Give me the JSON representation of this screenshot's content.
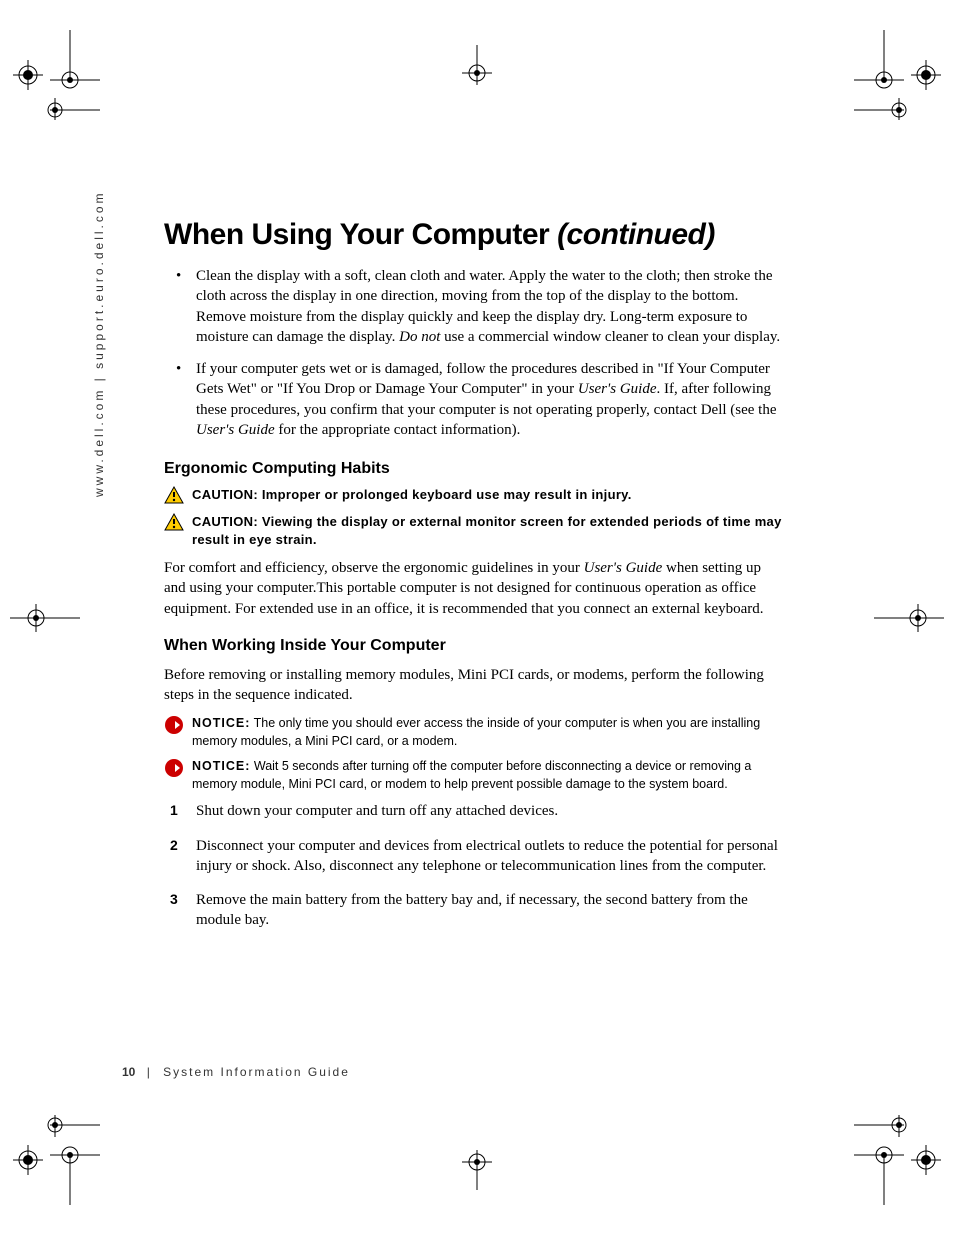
{
  "sidebar": "www.dell.com | support.euro.dell.com",
  "title_main": "When Using Your Computer ",
  "title_ital": "(continued)",
  "bullets": [
    {
      "pre": "Clean the display with a soft, clean cloth and water. Apply the water to the cloth; then stroke the cloth across the display in one direction, moving from the top of the display to the bottom. Remove moisture from the display quickly and keep the display dry. Long-term exposure to moisture can damage the display. ",
      "ital": "Do not",
      "post": " use a commercial window cleaner to clean your display."
    },
    {
      "pre": "If your computer gets wet or is damaged, follow the procedures described in \"If Your Computer Gets Wet\" or \"If You Drop or Damage Your Computer\" in your ",
      "ital": "User's Guide",
      "post": ". If, after following these procedures, you confirm that your computer is not operating properly, contact Dell (see the ",
      "ital2": "User's Guide",
      "post2": " for the appropriate contact information)."
    }
  ],
  "sub1": "Ergonomic Computing Habits",
  "cautions": [
    "CAUTION: Improper or prolonged keyboard use may result in injury.",
    "CAUTION: Viewing the display or external monitor screen for extended periods of time may result in eye strain."
  ],
  "para1_pre": "For comfort and efficiency, observe the ergonomic guidelines in your ",
  "para1_ital": "User's Guide",
  "para1_post": " when setting up and using your computer.This portable computer is not designed for continuous operation as office equipment. For extended use in an office, it is recommended that you connect an external keyboard.",
  "sub2": "When Working Inside Your Computer",
  "para2": "Before removing or installing memory modules, Mini PCI cards, or modems, perform the following steps in the sequence indicated.",
  "notices": [
    {
      "lead": "NOTICE:",
      "body": " The only time you should ever access the inside of your computer is when you are installing memory modules, a Mini PCI card, or a modem."
    },
    {
      "lead": "NOTICE:",
      "body": " Wait 5 seconds after turning off the computer before disconnecting a device or removing a memory module, Mini PCI card, or modem to help prevent possible damage to the system board."
    }
  ],
  "steps": [
    "Shut down your computer and turn off any attached devices.",
    "Disconnect your computer and devices from electrical outlets to reduce the potential for personal injury or shock. Also, disconnect any telephone or telecommunication lines from the computer.",
    "Remove the main battery from the battery bay and, if necessary, the second battery from the module bay."
  ],
  "footer_page": "10",
  "footer_label": "System Information Guide"
}
